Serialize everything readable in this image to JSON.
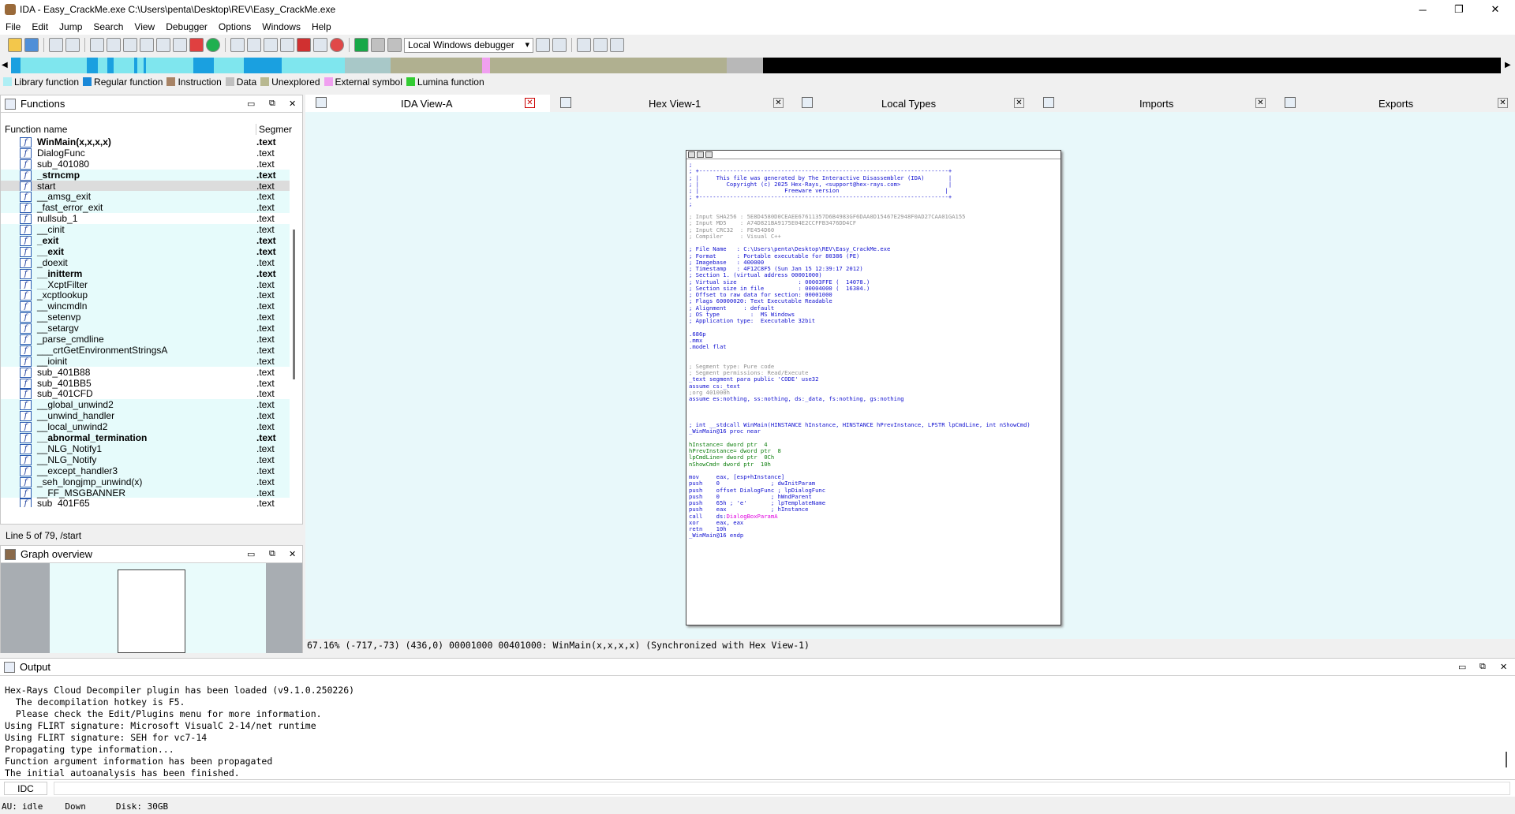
{
  "window": {
    "title": "IDA - Easy_CrackMe.exe C:\\Users\\penta\\Desktop\\REV\\Easy_CrackMe.exe",
    "min": "─",
    "max": "❐",
    "close": "✕"
  },
  "menu": [
    "File",
    "Edit",
    "Jump",
    "Search",
    "View",
    "Debugger",
    "Options",
    "Windows",
    "Help"
  ],
  "toolbar": {
    "debugger_select": "Local Windows debugger"
  },
  "navband": {
    "colors": {
      "library": "#7fe6ee",
      "regular": "#1aa0e0",
      "data": "#a8a88a",
      "unexplored": "#b8b8b8",
      "black": "#000000"
    }
  },
  "legend": [
    {
      "label": "Library function",
      "color": "#aeeef4"
    },
    {
      "label": "Regular function",
      "color": "#1a88d8"
    },
    {
      "label": "Instruction",
      "color": "#a88466"
    },
    {
      "label": "Data",
      "color": "#c0c0c0"
    },
    {
      "label": "Unexplored",
      "color": "#b8b890"
    },
    {
      "label": "External symbol",
      "color": "#f0a0f0"
    },
    {
      "label": "Lumina function",
      "color": "#33cc33"
    }
  ],
  "functions": {
    "title": "Functions",
    "col_name": "Function name",
    "col_seg": "Segmer",
    "status": "Line 5 of 79, /start",
    "rows": [
      {
        "name": "WinMain(x,x,x,x)",
        "seg": ".text",
        "bold": true,
        "lib": false
      },
      {
        "name": "DialogFunc",
        "seg": ".text",
        "bold": false,
        "lib": false
      },
      {
        "name": "sub_401080",
        "seg": ".text",
        "bold": false,
        "lib": false
      },
      {
        "name": "_strncmp",
        "seg": ".text",
        "bold": true,
        "lib": true
      },
      {
        "name": "start",
        "seg": ".text",
        "bold": false,
        "lib": true,
        "selected": true
      },
      {
        "name": "__amsg_exit",
        "seg": ".text",
        "bold": false,
        "lib": true
      },
      {
        "name": "_fast_error_exit",
        "seg": ".text",
        "bold": false,
        "lib": true
      },
      {
        "name": "nullsub_1",
        "seg": ".text",
        "bold": false,
        "lib": false
      },
      {
        "name": "__cinit",
        "seg": ".text",
        "bold": false,
        "lib": true
      },
      {
        "name": "_exit",
        "seg": ".text",
        "bold": true,
        "lib": true
      },
      {
        "name": "__exit",
        "seg": ".text",
        "bold": true,
        "lib": true
      },
      {
        "name": "_doexit",
        "seg": ".text",
        "bold": false,
        "lib": true
      },
      {
        "name": "__initterm",
        "seg": ".text",
        "bold": true,
        "lib": true
      },
      {
        "name": "__XcptFilter",
        "seg": ".text",
        "bold": false,
        "lib": true
      },
      {
        "name": "_xcptlookup",
        "seg": ".text",
        "bold": false,
        "lib": true
      },
      {
        "name": "__wincmdln",
        "seg": ".text",
        "bold": false,
        "lib": true
      },
      {
        "name": "__setenvp",
        "seg": ".text",
        "bold": false,
        "lib": true
      },
      {
        "name": "__setargv",
        "seg": ".text",
        "bold": false,
        "lib": true
      },
      {
        "name": "_parse_cmdline",
        "seg": ".text",
        "bold": false,
        "lib": true
      },
      {
        "name": "___crtGetEnvironmentStringsA",
        "seg": ".text",
        "bold": false,
        "lib": true
      },
      {
        "name": "__ioinit",
        "seg": ".text",
        "bold": false,
        "lib": true
      },
      {
        "name": "sub_401B88",
        "seg": ".text",
        "bold": false,
        "lib": false
      },
      {
        "name": "sub_401BB5",
        "seg": ".text",
        "bold": false,
        "lib": false
      },
      {
        "name": "sub_401CFD",
        "seg": ".text",
        "bold": false,
        "lib": false
      },
      {
        "name": "__global_unwind2",
        "seg": ".text",
        "bold": false,
        "lib": true
      },
      {
        "name": "__unwind_handler",
        "seg": ".text",
        "bold": false,
        "lib": true
      },
      {
        "name": "__local_unwind2",
        "seg": ".text",
        "bold": false,
        "lib": true
      },
      {
        "name": "__abnormal_termination",
        "seg": ".text",
        "bold": true,
        "lib": true
      },
      {
        "name": "__NLG_Notify1",
        "seg": ".text",
        "bold": false,
        "lib": true
      },
      {
        "name": "__NLG_Notify",
        "seg": ".text",
        "bold": false,
        "lib": true
      },
      {
        "name": "__except_handler3",
        "seg": ".text",
        "bold": false,
        "lib": true
      },
      {
        "name": "_seh_longjmp_unwind(x)",
        "seg": ".text",
        "bold": false,
        "lib": true
      },
      {
        "name": "__FF_MSGBANNER",
        "seg": ".text",
        "bold": false,
        "lib": true
      },
      {
        "name": "sub_401F65",
        "seg": ".text",
        "bold": false,
        "lib": false
      }
    ]
  },
  "graph_overview": {
    "title": "Graph overview"
  },
  "tabs": [
    {
      "label": "IDA View-A",
      "active": true
    },
    {
      "label": "Hex View-1",
      "active": false
    },
    {
      "label": "Local Types",
      "active": false
    },
    {
      "label": "Imports",
      "active": false
    },
    {
      "label": "Exports",
      "active": false
    }
  ],
  "ida_view": {
    "status": "67.16% (-717,-73) (436,0) 00001000 00401000: WinMain(x,x,x,x) (Synchronized with Hex View-1)",
    "lines": [
      {
        "t": ";",
        "c": "c0"
      },
      {
        "t": "; +-------------------------------------------------------------------------+",
        "c": "c0"
      },
      {
        "t": "; |     This file was generated by The Interactive Disassembler (IDA)       |",
        "c": "c0"
      },
      {
        "t": "; |        Copyright (c) 2025 Hex-Rays, <support@hex-rays.com>              |",
        "c": "c0"
      },
      {
        "t": "; |                         Freeware version                               |",
        "c": "c0"
      },
      {
        "t": "; +-------------------------------------------------------------------------+",
        "c": "c0"
      },
      {
        "t": ";",
        "c": "c0"
      },
      {
        "t": "",
        "c": "c0"
      },
      {
        "t": "; Input SHA256 : 5E8D4580D0CEAEE67611357D6B4983GF6DAA0D15467E2948F0AD27CAA01GA155",
        "c": "cg"
      },
      {
        "t": "; Input MD5    : A74D821BA9175E04E2CCFFB3476DD4CF",
        "c": "cg"
      },
      {
        "t": "; Input CRC32  : FE454D60",
        "c": "cg"
      },
      {
        "t": "; Compiler     : Visual C++",
        "c": "cg"
      },
      {
        "t": "",
        "c": "c0"
      },
      {
        "t": "; File Name   : C:\\Users\\penta\\Desktop\\REV\\Easy_CrackMe.exe",
        "c": "c0"
      },
      {
        "t": "; Format      : Portable executable for 80386 (PE)",
        "c": "c0"
      },
      {
        "t": "; Imagebase   : 400000",
        "c": "c0"
      },
      {
        "t": "; Timestamp   : 4F12C8F5 (Sun Jan 15 12:39:17 2012)",
        "c": "c0"
      },
      {
        "t": "; Section 1. (virtual address 00001000)",
        "c": "c0"
      },
      {
        "t": "; Virtual size                  : 00003FFE (  14078.)",
        "c": "c0"
      },
      {
        "t": "; Section size in file          : 00004000 (  16384.)",
        "c": "c0"
      },
      {
        "t": "; Offset to raw data for section: 00001000",
        "c": "c0"
      },
      {
        "t": "; Flags 60000020: Text Executable Readable",
        "c": "c0"
      },
      {
        "t": "; Alignment     : default",
        "c": "c0"
      },
      {
        "t": "; OS type         :  MS Windows",
        "c": "c0"
      },
      {
        "t": "; Application type:  Executable 32bit",
        "c": "c0"
      },
      {
        "t": "",
        "c": "c0"
      },
      {
        "t": ".686p",
        "c": "c0"
      },
      {
        "t": ".mmx",
        "c": "c0"
      },
      {
        "t": ".model flat",
        "c": "c0"
      },
      {
        "t": "",
        "c": "c0"
      },
      {
        "t": "",
        "c": "c0"
      },
      {
        "t": "; Segment type: Pure code",
        "c": "cg"
      },
      {
        "t": "; Segment permissions: Read/Execute",
        "c": "cg"
      },
      {
        "t": "_text segment para public 'CODE' use32",
        "c": "c0"
      },
      {
        "t": "assume cs:_text",
        "c": "c0"
      },
      {
        "t": ";org 401000h",
        "c": "cg"
      },
      {
        "t": "assume es:nothing, ss:nothing, ds:_data, fs:nothing, gs:nothing",
        "c": "c0"
      },
      {
        "t": "",
        "c": "c0"
      },
      {
        "t": "",
        "c": "c0"
      },
      {
        "t": "",
        "c": "c0"
      },
      {
        "t": "; int __stdcall WinMain(HINSTANCE hInstance, HINSTANCE hPrevInstance, LPSTR lpCmdLine, int nShowCmd)",
        "c": "c0"
      },
      {
        "t": "_WinMain@16 proc near",
        "c": "c0"
      },
      {
        "t": "",
        "c": "c0"
      },
      {
        "t": "hInstance= dword ptr  4",
        "c": "cgr"
      },
      {
        "t": "hPrevInstance= dword ptr  8",
        "c": "cgr"
      },
      {
        "t": "lpCmdLine= dword ptr  0Ch",
        "c": "cgr"
      },
      {
        "t": "nShowCmd= dword ptr  10h",
        "c": "cgr"
      },
      {
        "t": "",
        "c": "c0"
      },
      {
        "t": "mov     eax, [esp+hInstance]",
        "c": "c0"
      },
      {
        "t": "push    0               ; dwInitParam",
        "c": "c0"
      },
      {
        "t": "push    offset DialogFunc ; lpDialogFunc",
        "c": "c0"
      },
      {
        "t": "push    0               ; hWndParent",
        "c": "c0"
      },
      {
        "t": "push    65h ; 'e'       ; lpTemplateName",
        "c": "c0"
      },
      {
        "t": "push    eax             ; hInstance",
        "c": "c0"
      },
      {
        "t": "call    ds:DialogBoxParamA",
        "c": "c0"
      },
      {
        "t": "xor     eax, eax",
        "c": "c0"
      },
      {
        "t": "retn    10h",
        "c": "c0"
      },
      {
        "t": "_WinMain@16 endp",
        "c": "c0"
      }
    ]
  },
  "output": {
    "title": "Output",
    "lines": [
      "Hex-Rays Cloud Decompiler plugin has been loaded (v9.1.0.250226)",
      "  The decompilation hotkey is F5.",
      "  Please check the Edit/Plugins menu for more information.",
      "Using FLIRT signature: Microsoft VisualC 2-14/net runtime",
      "Using FLIRT signature: SEH for vc7-14",
      "Propagating type information...",
      "Function argument information has been propagated",
      "The initial autoanalysis has been finished."
    ]
  },
  "idc": {
    "label": "IDC"
  },
  "statusbar": {
    "au": "AU:",
    "state": "idle",
    "direction": "Down",
    "disk": "Disk: 30GB"
  }
}
